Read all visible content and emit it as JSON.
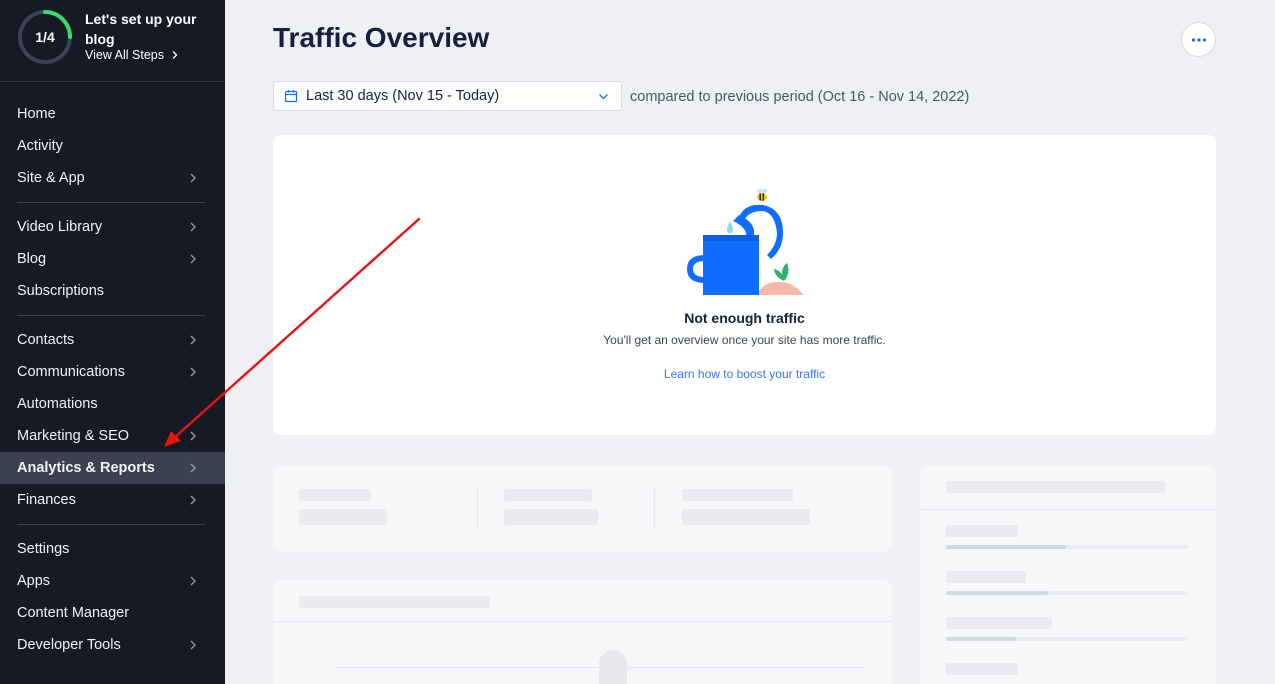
{
  "setup": {
    "progress_label": "1/4",
    "progress_fraction": 0.25,
    "title": "Let's set up your blog",
    "link": "View All Steps"
  },
  "sidebar": {
    "groups": [
      [
        {
          "label": "Home",
          "chevron": false
        },
        {
          "label": "Activity",
          "chevron": false
        },
        {
          "label": "Site & App",
          "chevron": true
        }
      ],
      [
        {
          "label": "Video Library",
          "chevron": true
        },
        {
          "label": "Blog",
          "chevron": true
        },
        {
          "label": "Subscriptions",
          "chevron": false
        }
      ],
      [
        {
          "label": "Contacts",
          "chevron": true
        },
        {
          "label": "Communications",
          "chevron": true
        },
        {
          "label": "Automations",
          "chevron": false
        },
        {
          "label": "Marketing & SEO",
          "chevron": true
        },
        {
          "label": "Analytics & Reports",
          "chevron": true,
          "active": true
        },
        {
          "label": "Finances",
          "chevron": true
        }
      ],
      [
        {
          "label": "Settings",
          "chevron": false
        },
        {
          "label": "Apps",
          "chevron": true
        },
        {
          "label": "Content Manager",
          "chevron": false
        },
        {
          "label": "Developer Tools",
          "chevron": true
        }
      ]
    ]
  },
  "header": {
    "title": "Traffic Overview"
  },
  "filter": {
    "date_range": "Last 30 days (Nov 15 - Today)",
    "compare_text": "compared to previous period (Oct 16 - Nov 14, 2022)"
  },
  "empty_state": {
    "title": "Not enough traffic",
    "subtitle": "You'll get an overview once your site has more traffic.",
    "link": "Learn how to boost your traffic"
  },
  "colors": {
    "sidebar_bg": "#151a24",
    "accent": "#116dff",
    "progress": "#3ad86f",
    "link": "#3a73f0",
    "annotation_arrow": "#e8140f"
  }
}
